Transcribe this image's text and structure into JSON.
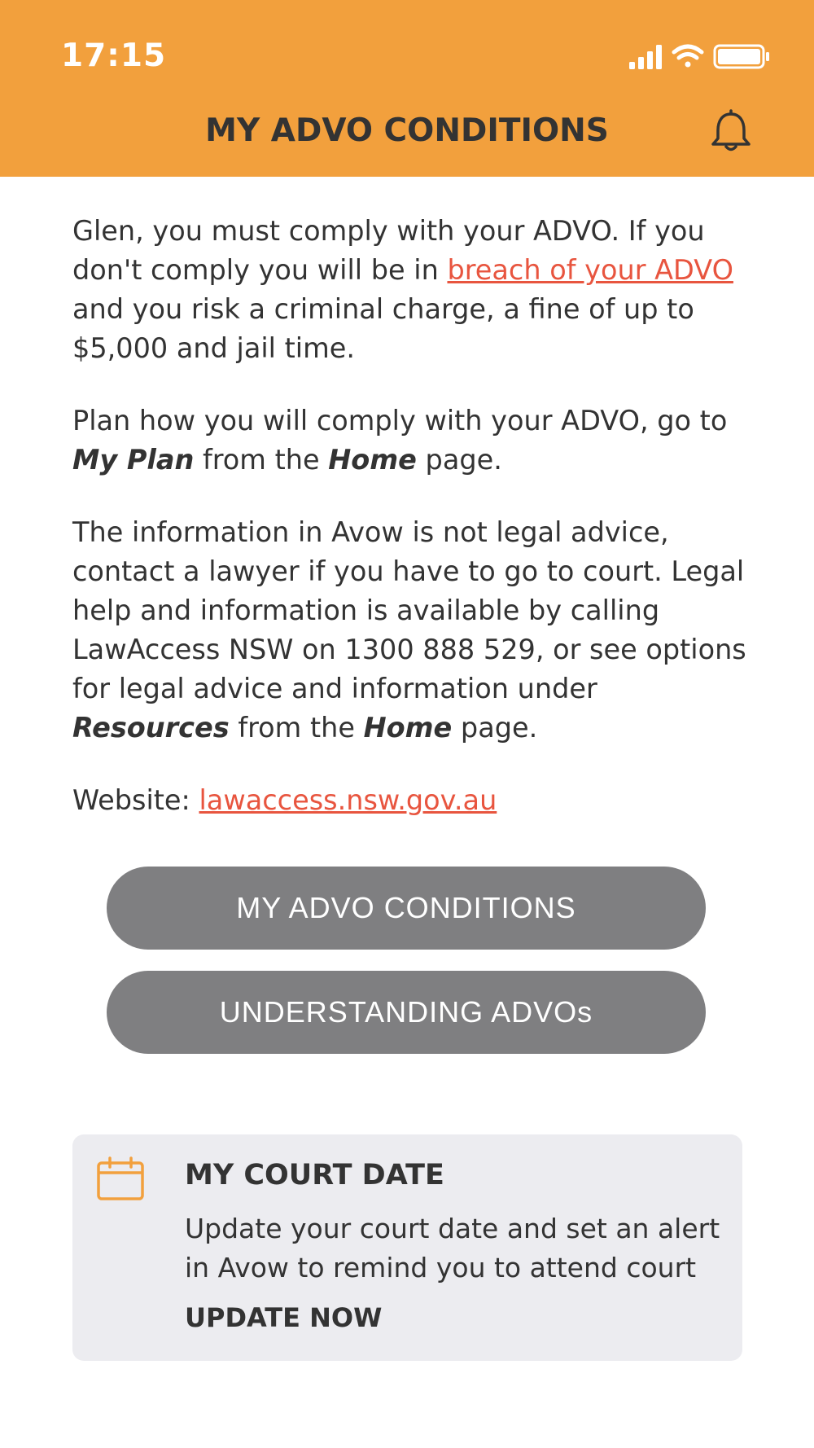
{
  "status_bar": {
    "time": "17:15"
  },
  "header": {
    "title": "MY ADVO CONDITIONS"
  },
  "body": {
    "para1_start": "Glen, you must comply with your ADVO. If you don't comply you will be in ",
    "para1_link": "breach of your ADVO",
    "para1_end": " and you risk a criminal charge, a fine of up to $5,000 and jail time.",
    "para2_start": "Plan how you will comply with your ADVO, go to ",
    "para2_em1": "My Plan",
    "para2_mid": " from the ",
    "para2_em2": "Home",
    "para2_end": " page.",
    "para3_start": "The information in Avow is not legal advice, contact a lawyer if you have to go to court. Legal help and information is available by calling LawAccess NSW on 1300 888 529, or see options for legal advice and information under ",
    "para3_em1": "Resources",
    "para3_mid": " from the ",
    "para3_em2": "Home",
    "para3_end": " page.",
    "website_label": "Website: ",
    "website_link": "lawaccess.nsw.gov.au"
  },
  "buttons": {
    "conditions": "MY ADVO CONDITIONS",
    "understanding": "UNDERSTANDING ADVOs"
  },
  "court_card": {
    "title": "MY COURT DATE",
    "text": "Update your court date and set an alert in Avow to remind you to attend court",
    "action": "UPDATE NOW"
  },
  "colors": {
    "header": "#f2a03d",
    "link": "#e8553f",
    "button": "#7f7f81",
    "card": "#ececf0",
    "icon_accent": "#f2a03d"
  },
  "icons": [
    "signal-icon",
    "wifi-icon",
    "battery-icon",
    "bell-icon",
    "calendar-icon"
  ]
}
